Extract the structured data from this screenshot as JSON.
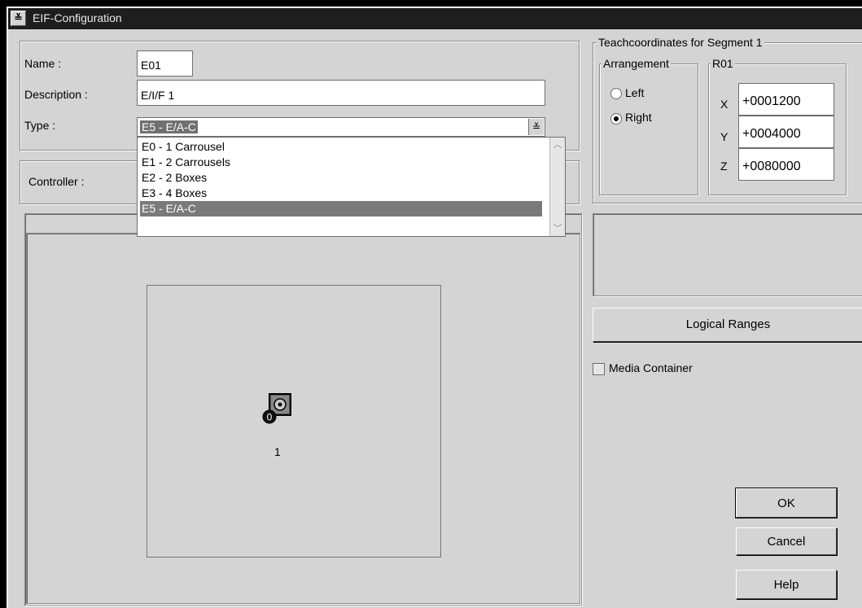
{
  "window": {
    "title": "EIF-Configuration"
  },
  "form": {
    "name_label": "Name :",
    "name_value": "E01",
    "description_label": "Description :",
    "description_value": "E/I/F 1",
    "type_label": "Type :",
    "type_value": "E5 - E/A-C",
    "type_options": [
      "E0 - 1 Carrousel",
      "E1 - 2 Carrousels",
      "E2 - 2 Boxes",
      "E3 - 4 Boxes",
      "E5 - E/A-C"
    ],
    "type_selected_index": 4,
    "controller_label": "Controller :"
  },
  "teach": {
    "group_title": "Teachcoordinates for Segment 1",
    "arrangement_title": "Arrangement",
    "arrangement_options": [
      {
        "label": "Left",
        "checked": false
      },
      {
        "label": "Right",
        "checked": true
      }
    ],
    "r_group_title": "R01",
    "coords": [
      {
        "axis": "X",
        "value": "+0001200"
      },
      {
        "axis": "Y",
        "value": "+0004000"
      },
      {
        "axis": "Z",
        "value": "+0080000"
      }
    ]
  },
  "logical_ranges_button": "Logical Ranges",
  "media_container": {
    "label": "Media Container",
    "checked": false
  },
  "canvas": {
    "item_label": "1",
    "badge": "0",
    "icon": "media-drive-icon"
  },
  "buttons": {
    "ok": "OK",
    "cancel": "Cancel",
    "help": "Help"
  },
  "colors": {
    "window_bg": "#d4d4d4",
    "titlebar_bg": "#1e1e1e",
    "selection_bg": "#7a7a7a"
  }
}
